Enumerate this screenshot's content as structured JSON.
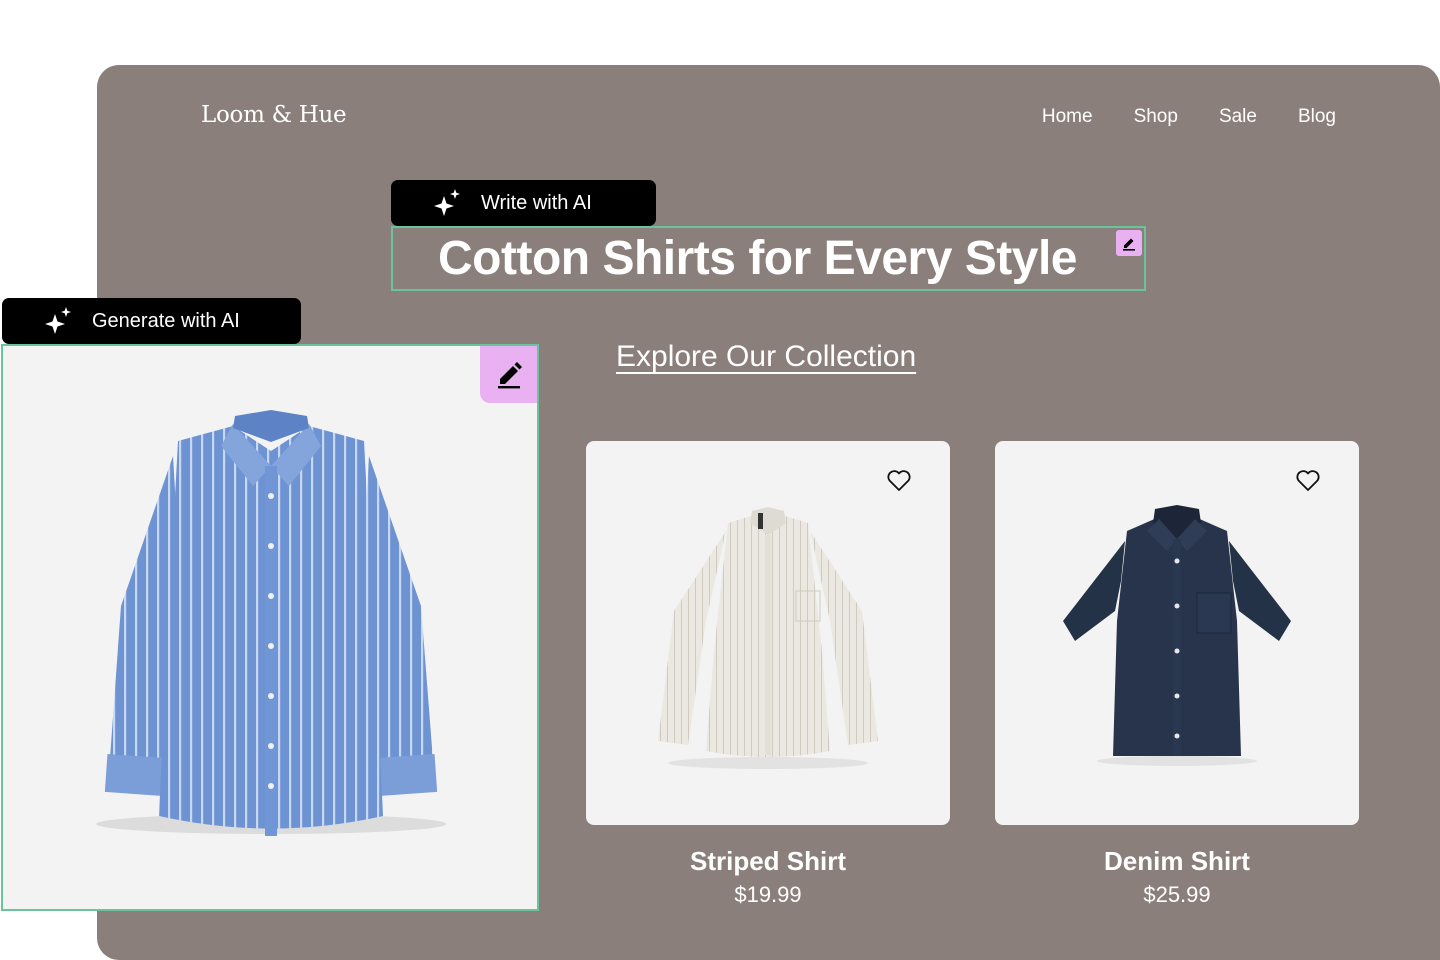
{
  "brand": "Loom & Hue",
  "nav": [
    "Home",
    "Shop",
    "Sale",
    "Blog"
  ],
  "ai_tools": {
    "write_label": "Write with AI",
    "generate_label": "Generate with AI"
  },
  "hero": {
    "headline": "Cotton Shirts for Every Style",
    "cta": "Explore Our Collection"
  },
  "products": [
    {
      "name": "Striped Shirt",
      "price": "$19.99"
    },
    {
      "name": "Denim Shirt",
      "price": "$25.99"
    }
  ],
  "colors": {
    "site_background": "#8a7f7b",
    "selection_outline": "#6ac39a",
    "edit_badge": "#e9b1f1",
    "ai_pill": "#000000"
  }
}
